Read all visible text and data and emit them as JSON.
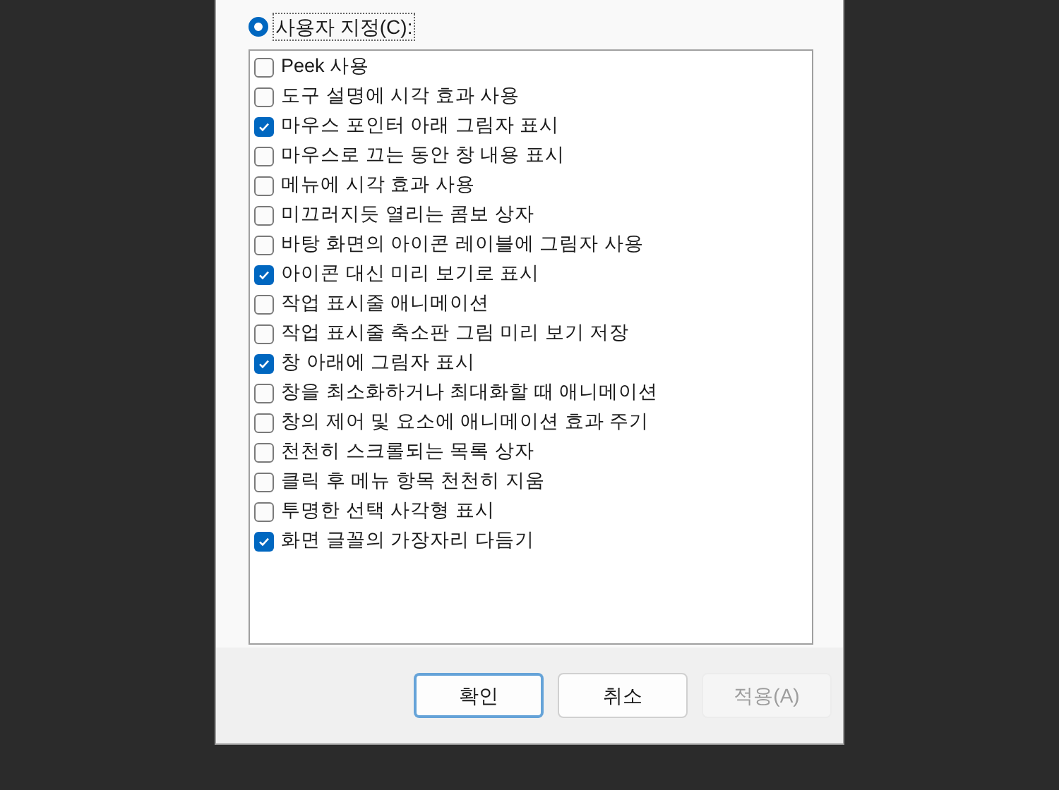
{
  "custom_option": {
    "label": "사용자 지정(C):",
    "selected": true
  },
  "options": [
    {
      "label": "Peek 사용",
      "checked": false
    },
    {
      "label": "도구 설명에 시각 효과 사용",
      "checked": false
    },
    {
      "label": "마우스 포인터 아래 그림자 표시",
      "checked": true
    },
    {
      "label": "마우스로 끄는 동안 창 내용 표시",
      "checked": false
    },
    {
      "label": "메뉴에 시각 효과 사용",
      "checked": false
    },
    {
      "label": "미끄러지듯 열리는 콤보 상자",
      "checked": false
    },
    {
      "label": "바탕 화면의 아이콘 레이블에 그림자 사용",
      "checked": false
    },
    {
      "label": "아이콘 대신 미리 보기로 표시",
      "checked": true
    },
    {
      "label": "작업 표시줄 애니메이션",
      "checked": false
    },
    {
      "label": "작업 표시줄 축소판 그림 미리 보기 저장",
      "checked": false
    },
    {
      "label": "창 아래에 그림자 표시",
      "checked": true
    },
    {
      "label": "창을 최소화하거나 최대화할 때 애니메이션",
      "checked": false
    },
    {
      "label": "창의 제어 및 요소에 애니메이션 효과 주기",
      "checked": false
    },
    {
      "label": "천천히 스크롤되는 목록 상자",
      "checked": false
    },
    {
      "label": "클릭 후 메뉴 항목 천천히 지움",
      "checked": false
    },
    {
      "label": "투명한 선택 사각형 표시",
      "checked": false
    },
    {
      "label": "화면 글꼴의 가장자리 다듬기",
      "checked": true
    }
  ],
  "buttons": [
    {
      "label": "확인",
      "kind": "default",
      "disabled": false
    },
    {
      "label": "취소",
      "kind": "normal",
      "disabled": false
    },
    {
      "label": "적용(A)",
      "kind": "normal",
      "disabled": true
    }
  ]
}
